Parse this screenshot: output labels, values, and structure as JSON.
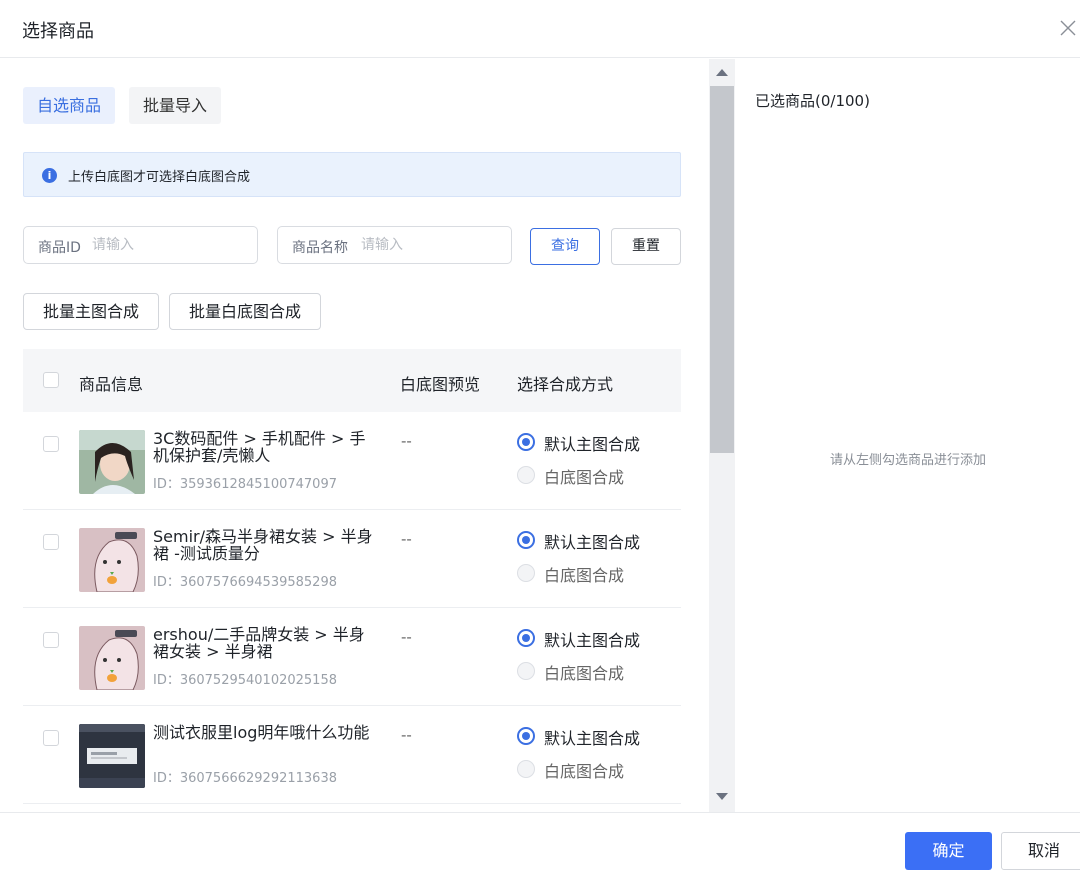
{
  "dialog": {
    "title": "选择商品"
  },
  "tabs": [
    {
      "label": "自选商品",
      "active": true
    },
    {
      "label": "批量导入",
      "active": false
    }
  ],
  "notice": {
    "text": "上传白底图才可选择白底图合成"
  },
  "search": {
    "id_label": "商品ID",
    "id_placeholder": "请输入",
    "name_label": "商品名称",
    "name_placeholder": "请输入",
    "query": "查询",
    "reset": "重置"
  },
  "batch": {
    "main": "批量主图合成",
    "white": "批量白底图合成"
  },
  "table": {
    "headers": {
      "info": "商品信息",
      "preview": "白底图预览",
      "method": "选择合成方式"
    },
    "option_default": "默认主图合成",
    "option_white": "白底图合成",
    "rows": [
      {
        "name": "3C数码配件 > 手机配件 > 手机保护套/壳懒人",
        "id": "ID：3593612845100747097",
        "preview": "--",
        "selected": "default",
        "thumb": "portrait-photo"
      },
      {
        "name": "Semir/森马半身裙女装 > 半身裙 -测试质量分",
        "id": "ID：3607576694539585298",
        "preview": "--",
        "selected": "default",
        "thumb": "cartoon-pink"
      },
      {
        "name": "ershou/二手品牌女装 > 半身裙女装 > 半身裙",
        "id": "ID：3607529540102025158",
        "preview": "--",
        "selected": "default",
        "thumb": "cartoon-pink"
      },
      {
        "name": "测试衣服里log明年哦什么功能",
        "id": "ID：3607566629292113638",
        "preview": "--",
        "selected": "default",
        "thumb": "screenshot-dark"
      }
    ]
  },
  "selected": {
    "title": "已选商品(0/100)",
    "empty_text": "请从左侧勾选商品进行添加"
  },
  "footer": {
    "ok": "确定",
    "cancel": "取消"
  },
  "colors": {
    "primary": "#3b6ff5",
    "notice_bg": "#eaf2fd"
  }
}
